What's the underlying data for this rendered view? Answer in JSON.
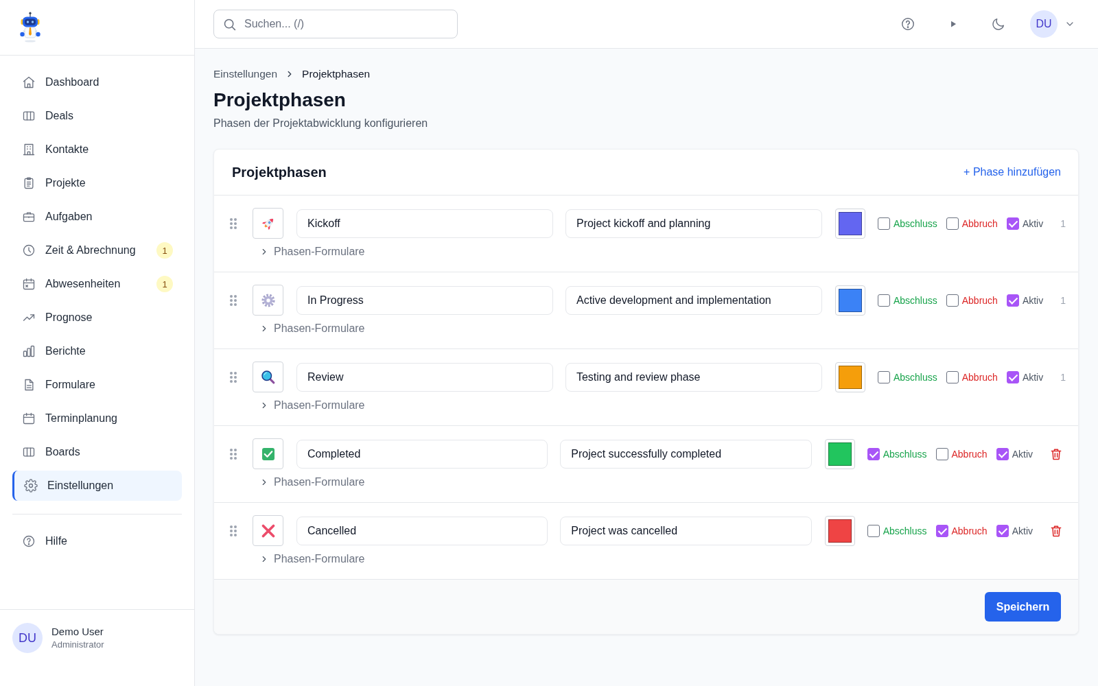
{
  "sidebar": {
    "nav_items": [
      {
        "label": "Dashboard",
        "kind": "home",
        "selected": false
      },
      {
        "label": "Deals",
        "kind": "columns",
        "selected": false
      },
      {
        "label": "Kontakte",
        "kind": "building",
        "selected": false
      },
      {
        "label": "Projekte",
        "kind": "clipboard",
        "selected": false
      },
      {
        "label": "Aufgaben",
        "kind": "briefcase",
        "selected": false
      },
      {
        "label": "Zeit & Abrechnung",
        "kind": "clock",
        "selected": false,
        "badge": "1"
      },
      {
        "label": "Abwesenheiten",
        "kind": "calendarx",
        "selected": false,
        "badge": "1"
      },
      {
        "label": "Prognose",
        "kind": "trend",
        "selected": false
      },
      {
        "label": "Berichte",
        "kind": "chart",
        "selected": false
      },
      {
        "label": "Formulare",
        "kind": "document",
        "selected": false
      },
      {
        "label": "Terminplanung",
        "kind": "calendar",
        "selected": false
      },
      {
        "label": "Boards",
        "kind": "columns",
        "selected": false
      },
      {
        "label": "Einstellungen",
        "kind": "gear",
        "selected": true
      }
    ],
    "footer_items": [
      {
        "label": "Hilfe",
        "kind": "help",
        "selected": false
      }
    ],
    "user": {
      "initials": "DU",
      "name": "Demo User",
      "role": "Administrator"
    }
  },
  "top_bar": {
    "search": {
      "placeholder": "Suchen... (/)"
    },
    "avatar": {
      "initials": "DU"
    }
  },
  "breadcrumb": [
    "Einstellungen",
    "Projektphasen"
  ],
  "header": {
    "title": "Projektphasen",
    "subtitle": "Phasen der Projektabwicklung konfigurieren"
  },
  "phases_card": {
    "title": "Projektphasen",
    "add_link": "+ Phase hinzufügen",
    "phases": [
      {
        "kind": "rocket",
        "name": "Kickoff",
        "description": "Project kickoff and planning",
        "color": "#6366f1",
        "options": [
          {
            "kind": "final",
            "label": "Abschluss",
            "checked": false
          },
          {
            "kind": "cancel",
            "label": "Abbruch",
            "checked": false
          },
          {
            "kind": "active",
            "label": "Aktiv",
            "checked": true
          }
        ],
        "count": "1",
        "deletable": false,
        "forms_toggle": {
          "label": "Phasen-Formulare",
          "expanded": false
        }
      },
      {
        "kind": "gear",
        "name": "In Progress",
        "description": "Active development and implementation",
        "color": "#3b82f6",
        "options": [
          {
            "kind": "final",
            "label": "Abschluss",
            "checked": false
          },
          {
            "kind": "cancel",
            "label": "Abbruch",
            "checked": false
          },
          {
            "kind": "active",
            "label": "Aktiv",
            "checked": true
          }
        ],
        "count": "1",
        "deletable": false,
        "forms_toggle": {
          "label": "Phasen-Formulare",
          "expanded": false
        }
      },
      {
        "kind": "magnifier",
        "name": "Review",
        "description": "Testing and review phase",
        "color": "#f59e0b",
        "options": [
          {
            "kind": "final",
            "label": "Abschluss",
            "checked": false
          },
          {
            "kind": "cancel",
            "label": "Abbruch",
            "checked": false
          },
          {
            "kind": "active",
            "label": "Aktiv",
            "checked": true
          }
        ],
        "count": "1",
        "deletable": false,
        "forms_toggle": {
          "label": "Phasen-Formulare",
          "expanded": false
        }
      },
      {
        "kind": "check",
        "name": "Completed",
        "description": "Project successfully completed",
        "color": "#22c55e",
        "options": [
          {
            "kind": "final",
            "label": "Abschluss",
            "checked": true
          },
          {
            "kind": "cancel",
            "label": "Abbruch",
            "checked": false
          },
          {
            "kind": "active",
            "label": "Aktiv",
            "checked": true
          }
        ],
        "deletable": true,
        "forms_toggle": {
          "label": "Phasen-Formulare",
          "expanded": false
        }
      },
      {
        "kind": "cross",
        "name": "Cancelled",
        "description": "Project was cancelled",
        "color": "#ef4444",
        "options": [
          {
            "kind": "final",
            "label": "Abschluss",
            "checked": false
          },
          {
            "kind": "cancel",
            "label": "Abbruch",
            "checked": true
          },
          {
            "kind": "active",
            "label": "Aktiv",
            "checked": true
          }
        ],
        "deletable": true,
        "forms_toggle": {
          "label": "Phasen-Formulare",
          "expanded": false
        }
      }
    ],
    "save_button": "Speichern"
  }
}
